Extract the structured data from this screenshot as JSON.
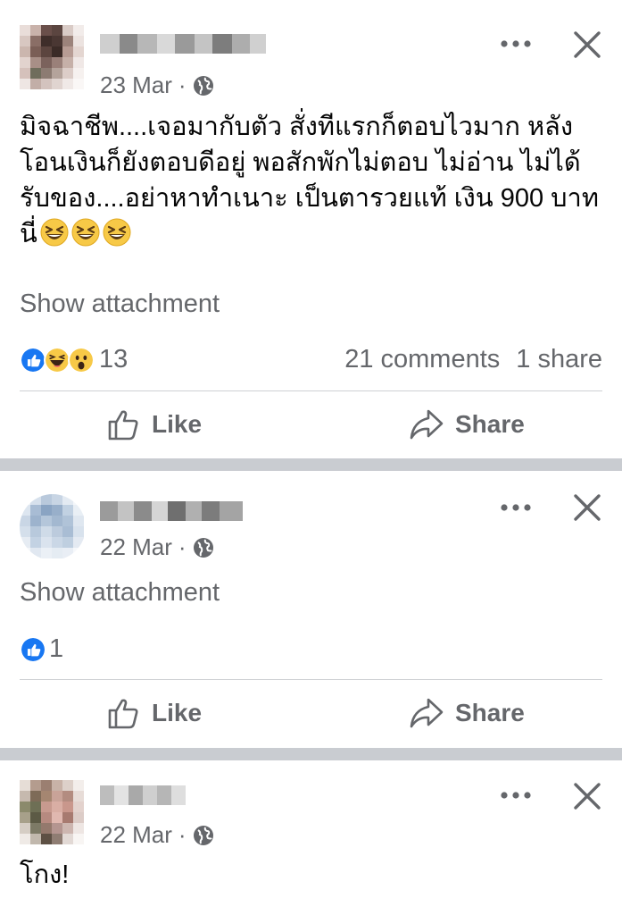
{
  "posts": [
    {
      "date": "23 Mar",
      "separator": "·",
      "text": "มิจฉาชีพ....เจอมากับตัว สั่งทีแรกก็ตอบไวมาก หลังโอนเงินก็ยังตอบดีอยู่ พอสักพักไม่ตอบ ไม่อ่าน ไม่ได้รับของ....อย่าหาทำเนาะ เป็นตารวยแท้ เงิน 900 บาทนี่",
      "emojis": [
        "grinning-squinting-face",
        "grinning-squinting-face",
        "grinning-squinting-face"
      ],
      "attachment_label": "Show attachment",
      "reactions": [
        "like",
        "haha",
        "wow"
      ],
      "reaction_count": "13",
      "comments": "21 comments",
      "shares": "1 share",
      "like_label": "Like",
      "share_label": "Share"
    },
    {
      "date": "22 Mar",
      "separator": "·",
      "attachment_label": "Show attachment",
      "reactions": [
        "like"
      ],
      "reaction_count": "1",
      "like_label": "Like",
      "share_label": "Share"
    },
    {
      "date": "22 Mar",
      "separator": "·",
      "text": "โกง!"
    }
  ],
  "icons": {
    "more": "more-horizontal-icon",
    "close": "close-icon",
    "audience": "globe-icon",
    "like": "thumbs-up-icon",
    "share": "share-arrow-icon"
  },
  "colors": {
    "like_blue": "#1877f2",
    "haha_yellow": "#f7c947",
    "secondary_text": "#65676b",
    "divider": "#c9ccd1"
  }
}
